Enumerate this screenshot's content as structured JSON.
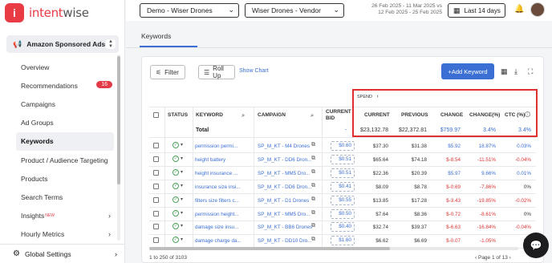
{
  "brand": {
    "mark": "i",
    "name_a": "intent",
    "name_b": "wise"
  },
  "app_selector": {
    "label": "Amazon Sponsored Ads"
  },
  "nav": [
    {
      "label": "Overview"
    },
    {
      "label": "Recommendations",
      "badge": "16"
    },
    {
      "label": "Campaigns"
    },
    {
      "label": "Ad Groups"
    },
    {
      "label": "Keywords",
      "active": true
    },
    {
      "label": "Product / Audience Targeting"
    },
    {
      "label": "Products"
    },
    {
      "label": "Search Terms"
    },
    {
      "label": "Insights",
      "tag": "NEW",
      "arrow": true
    },
    {
      "label": "Hourly Metrics",
      "arrow": true
    }
  ],
  "global_settings": {
    "label": "Global Settings"
  },
  "topbar": {
    "account": "Demo - Wiser Drones",
    "profile": "Wiser Drones - Vendor",
    "range_line1": "26 Feb 2025 - 11 Mar 2025 vs",
    "range_line2": "12 Feb 2025 - 25 Feb 2025",
    "preset": "Last 14 days"
  },
  "page_tab": "Keywords",
  "toolbar": {
    "filter": "Filter",
    "rollup": "Roll Up",
    "show_chart": "Show Chart",
    "add_keyword": "+Add Keyword"
  },
  "table": {
    "headers": {
      "status": "STATUS",
      "keyword": "KEYWORD",
      "campaign": "CAMPAIGN",
      "bid_a": "CURRENT",
      "bid_b": "BID",
      "spend": "SPEND",
      "current": "CURRENT",
      "previous": "PREVIOUS",
      "change": "CHANGE",
      "change_pct": "CHANGE(%)",
      "ctc": "CTC (%)"
    },
    "total": {
      "label": "Total",
      "bid": "-",
      "current": "$23,132.78",
      "previous": "$22,372.81",
      "change": "$759.97",
      "change_pct": "3.4%",
      "ctc": "3.4%"
    },
    "rows": [
      {
        "keyword": "permission permi...",
        "campaign": "SP_M_KT - M4 Drones",
        "bid": "$0.60",
        "current": "$37.30",
        "previous": "$31.38",
        "change": "$5.92",
        "change_pct": "18.87%",
        "ctc": "0.03%",
        "sign": "pos"
      },
      {
        "keyword": "height battery",
        "campaign": "SP_M_KT - DD6 Dron...",
        "bid": "$0.51",
        "current": "$65.64",
        "previous": "$74.18",
        "change": "$-8.54",
        "change_pct": "-11.51%",
        "ctc": "-0.04%",
        "sign": "neg"
      },
      {
        "keyword": "height insurance ...",
        "campaign": "SP_M_KT - MM5 Dro...",
        "bid": "$0.51",
        "current": "$22.36",
        "previous": "$20.39",
        "change": "$5.97",
        "change_pct": "9.66%",
        "ctc": "0.01%",
        "sign": "pos"
      },
      {
        "keyword": "insurance size insi...",
        "campaign": "SP_M_KT - DD6 Dron...",
        "bid": "$0.41",
        "current": "$8.09",
        "previous": "$8.78",
        "change": "$-0.69",
        "change_pct": "-7.86%",
        "ctc": "0%",
        "sign": "neg"
      },
      {
        "keyword": "filters size filters c...",
        "campaign": "SP_M_KT - D1 Drones",
        "bid": "$0.55",
        "current": "$13.85",
        "previous": "$17.28",
        "change": "$-3.43",
        "change_pct": "-19.85%",
        "ctc": "-0.02%",
        "sign": "neg"
      },
      {
        "keyword": "permission height...",
        "campaign": "SP_M_KT - MM5 Dro...",
        "bid": "$0.50",
        "current": "$7.64",
        "previous": "$8.36",
        "change": "$-0.72",
        "change_pct": "-8.61%",
        "ctc": "0%",
        "sign": "neg"
      },
      {
        "keyword": "damage size insu...",
        "campaign": "SP_M_KT - BB6 Drones",
        "bid": "$0.40",
        "current": "$32.74",
        "previous": "$39.37",
        "change": "$-6.63",
        "change_pct": "-16.84%",
        "ctc": "-0.04%",
        "sign": "neg"
      },
      {
        "keyword": "damage charge da...",
        "campaign": "SP_M_KT - DD10 Dro...",
        "bid": "$1.60",
        "current": "$6.62",
        "previous": "$6.69",
        "change": "$-0.07",
        "change_pct": "-1.05%",
        "ctc": "0%",
        "sign": "neg"
      }
    ]
  },
  "pager": {
    "range": "1 to 250 of 3103",
    "page": "Page 1 of 13"
  }
}
